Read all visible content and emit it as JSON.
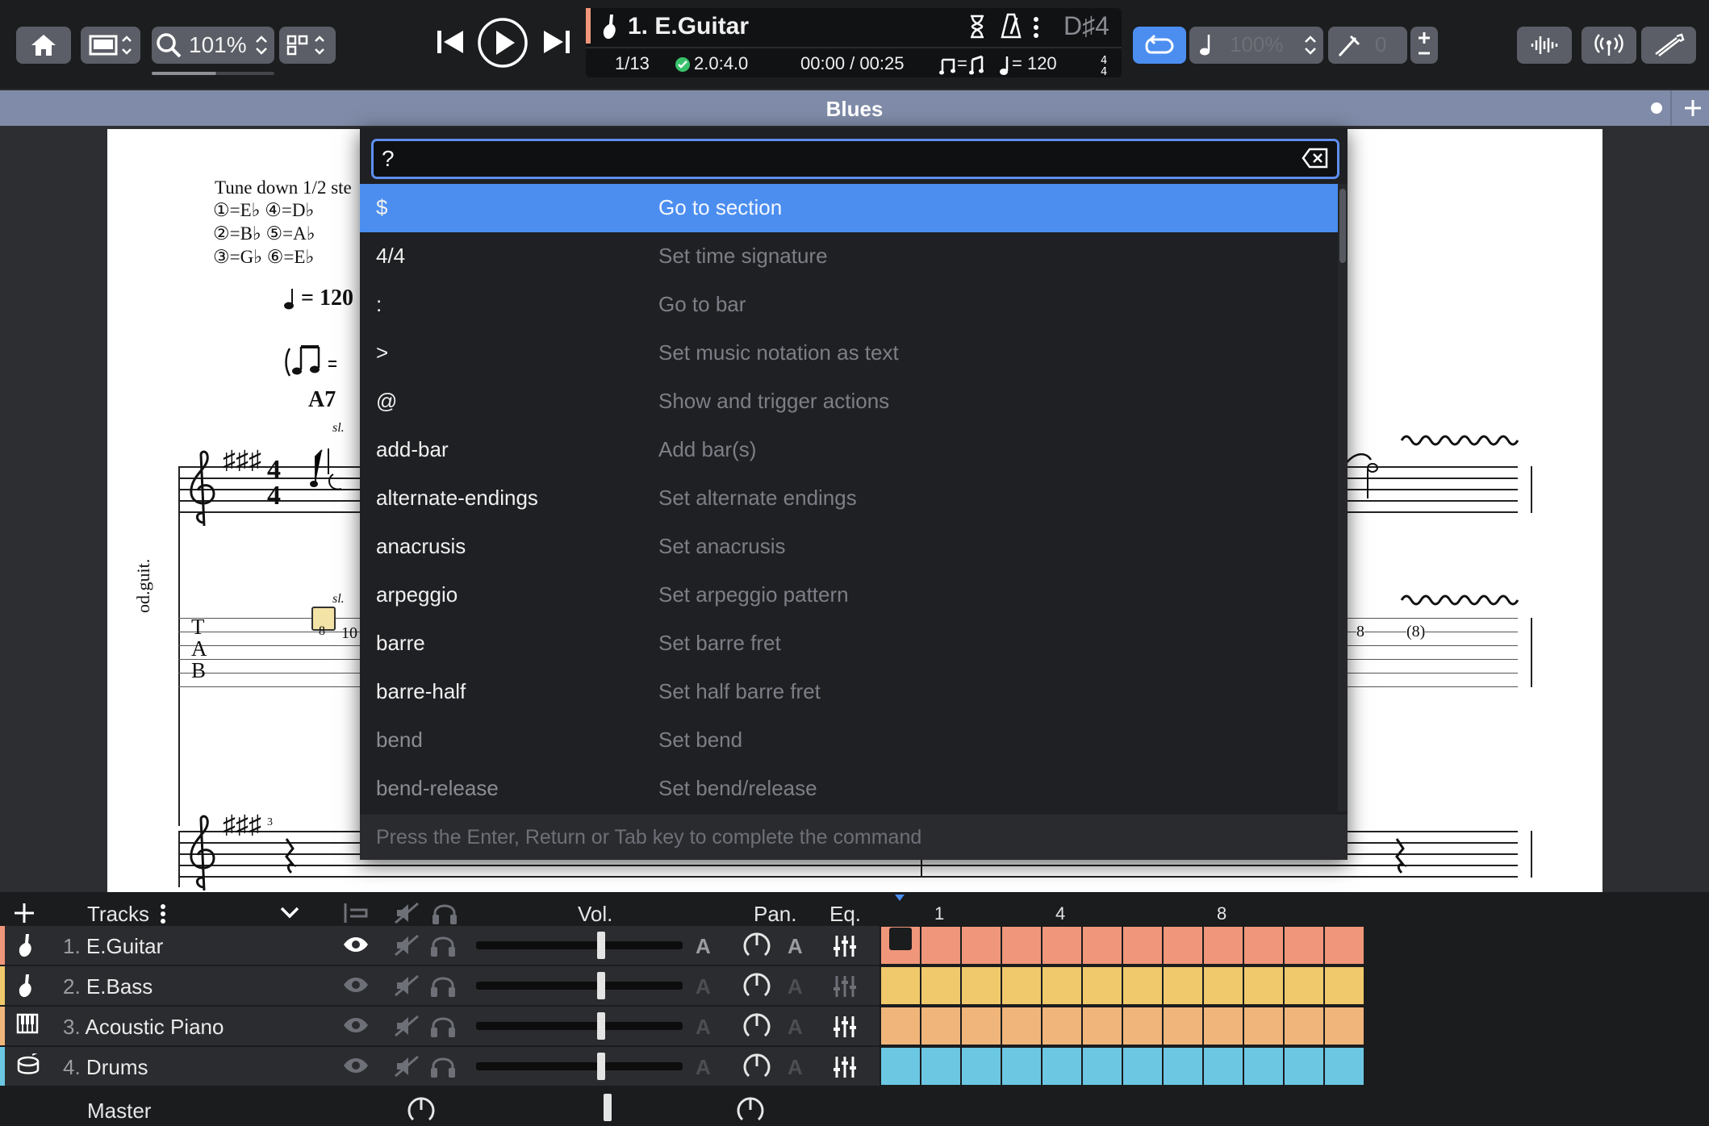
{
  "toolbar": {
    "zoom_value": "101%",
    "lcd": {
      "track_title": "1. E.Guitar",
      "bar_position": "1/13",
      "version": "2.0:4.0",
      "time": "00:00 / 00:25",
      "tempo_eq": "=",
      "tempo_value": "= 120",
      "key": "D♯4"
    },
    "speed_value": "100%",
    "capo_value": "0"
  },
  "banner": {
    "title": "Blues"
  },
  "score": {
    "tuning_title": "Tune down 1/2 ste",
    "tuning_rows": [
      "①=E♭ ④=D♭",
      "②=B♭ ⑤=A♭",
      "③=G♭ ⑥=E♭"
    ],
    "tempo_mark": "= 120",
    "chord": "A7",
    "slide_label": "sl.",
    "slide_label_tab": "sl.",
    "instrument_label": "od.guit.",
    "tab_clef": [
      "T",
      "A",
      "B"
    ],
    "tab_fret_left": "8",
    "tab_fret_left2": "10",
    "tab_fret_right": "8",
    "tab_fret_right2": "(8)",
    "bar_number": "3",
    "time_sig_top": "4",
    "time_sig_bottom": "4"
  },
  "palette": {
    "query": "?",
    "items": [
      {
        "cmd": "$",
        "desc": "Go to section"
      },
      {
        "cmd": "4/4",
        "desc": "Set time signature"
      },
      {
        "cmd": ":",
        "desc": "Go to bar"
      },
      {
        "cmd": ">",
        "desc": "Set music notation as text"
      },
      {
        "cmd": "@",
        "desc": "Show and trigger actions"
      },
      {
        "cmd": "add-bar",
        "desc": "Add bar(s)"
      },
      {
        "cmd": "alternate-endings",
        "desc": "Set alternate endings"
      },
      {
        "cmd": "anacrusis",
        "desc": "Set anacrusis"
      },
      {
        "cmd": "arpeggio",
        "desc": "Set arpeggio pattern"
      },
      {
        "cmd": "barre",
        "desc": "Set barre fret"
      },
      {
        "cmd": "barre-half",
        "desc": "Set half barre fret"
      },
      {
        "cmd": "bend",
        "desc": "Set bend"
      },
      {
        "cmd": "bend-release",
        "desc": "Set bend/release"
      }
    ],
    "hint": "Press the Enter, Return or Tab key to complete the command"
  },
  "tracks_panel": {
    "header_label": "Tracks",
    "vol_label": "Vol.",
    "pan_label": "Pan.",
    "eq_label": "Eq.",
    "bar_markers": [
      "1",
      "4",
      "8"
    ],
    "tracks": [
      {
        "num": "1.",
        "name": "E.Guitar",
        "color": "#f0967a"
      },
      {
        "num": "2.",
        "name": "E.Bass",
        "color": "#efc96b"
      },
      {
        "num": "3.",
        "name": "Acoustic Piano",
        "color": "#f0b57a"
      },
      {
        "num": "4.",
        "name": "Drums",
        "color": "#6cc7e3"
      }
    ],
    "master_label": "Master"
  }
}
